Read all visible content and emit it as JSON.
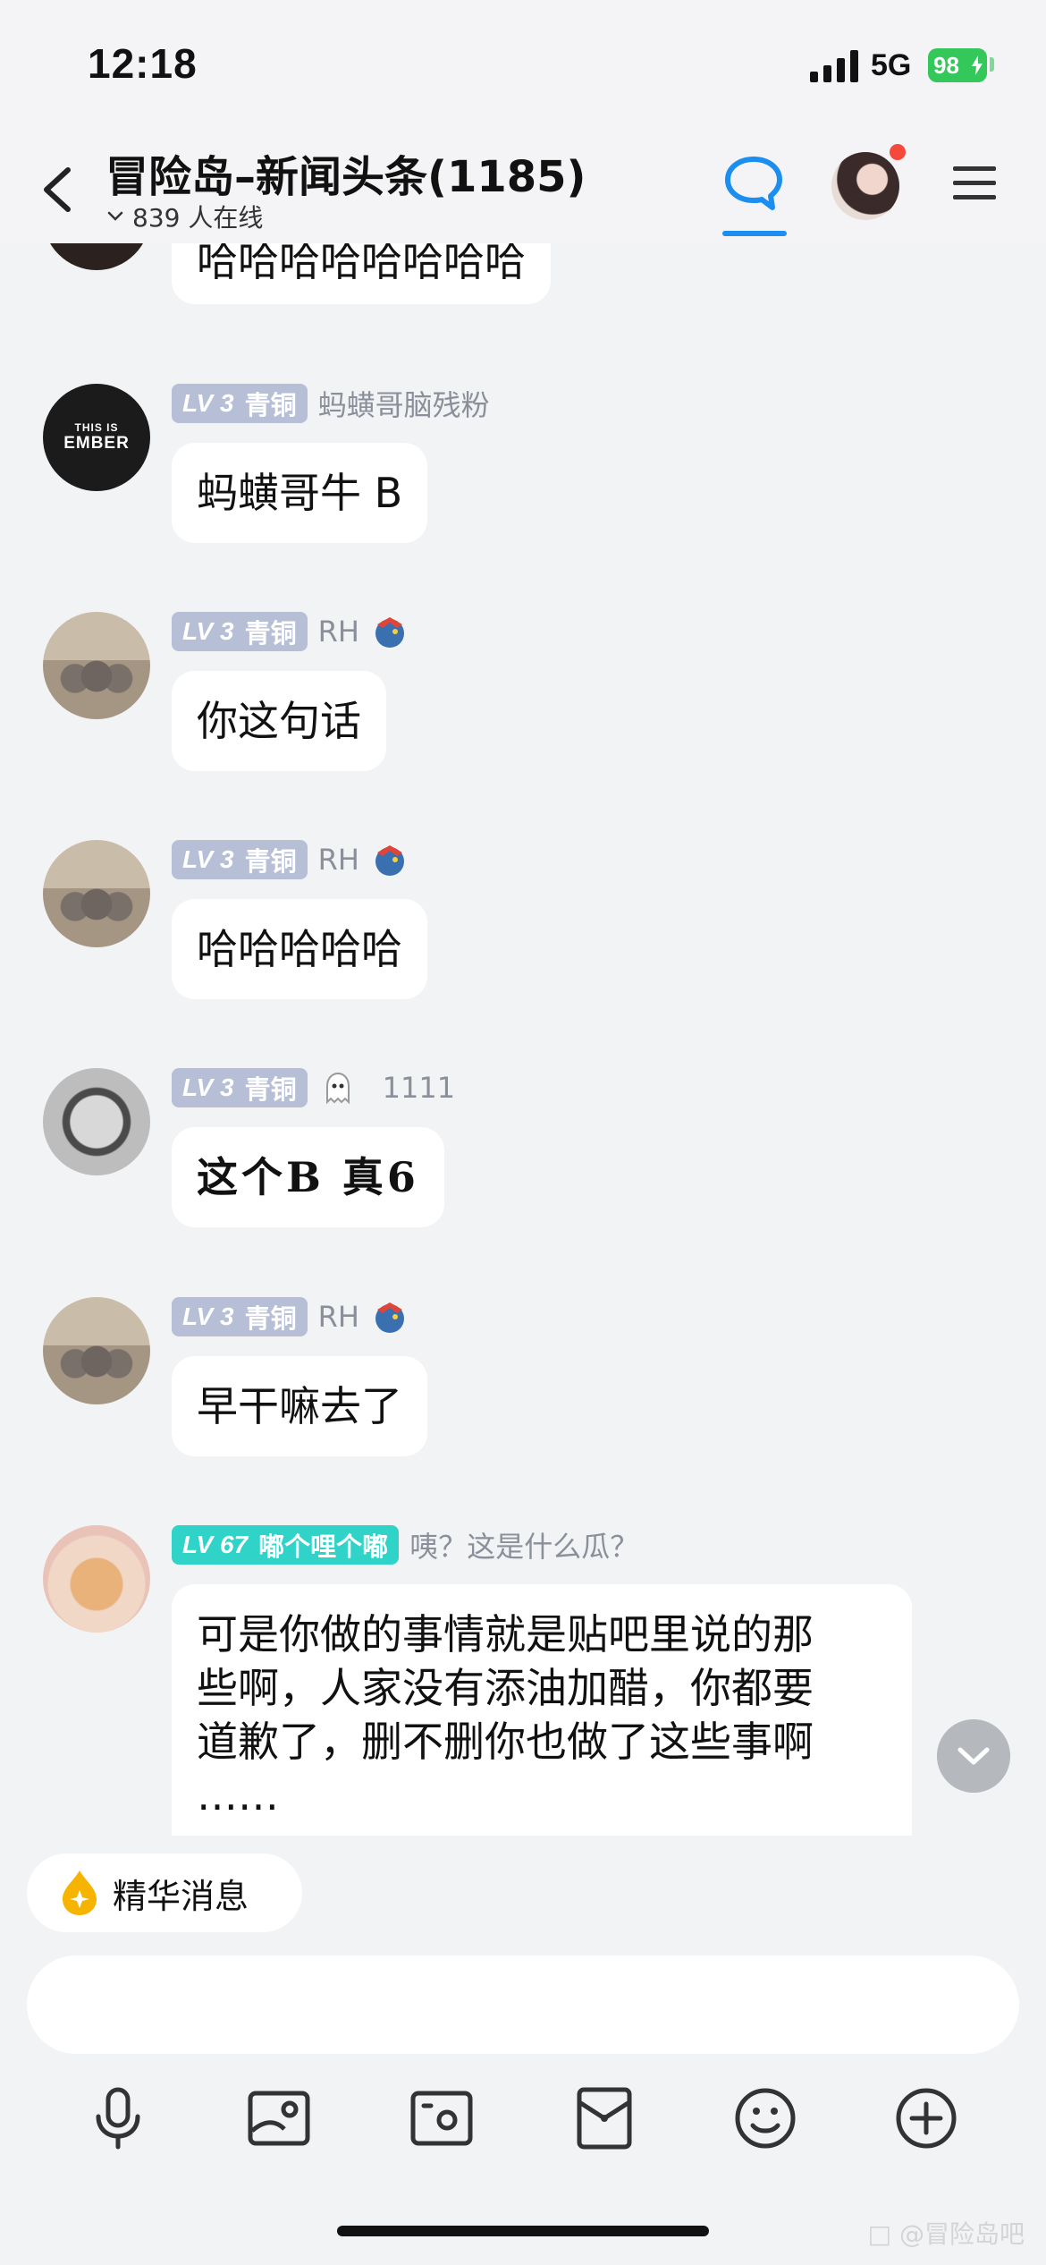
{
  "status_bar": {
    "time": "12:18",
    "network": "5G",
    "battery": "98"
  },
  "header": {
    "title": "冒险岛–新闻头条(1185)",
    "online": "839 人在线"
  },
  "partial_message": {
    "text": "哈哈哈哈哈哈哈哈"
  },
  "messages": [
    {
      "level": "LV 3",
      "rank": "青铜",
      "nickname": "蚂蟥哥脑残粉",
      "text": "蚂蟥哥牛 B",
      "avatar": "ember",
      "avatar_text": [
        "THIS IS",
        "EMBER"
      ]
    },
    {
      "level": "LV 3",
      "rank": "青铜",
      "nickname": "RH",
      "text": "你这句话",
      "avatar": "sand",
      "badge_icon": "dragon-icon"
    },
    {
      "level": "LV 3",
      "rank": "青铜",
      "nickname": "RH",
      "text": "哈哈哈哈哈",
      "avatar": "sand",
      "badge_icon": "dragon-icon"
    },
    {
      "level": "LV 3",
      "rank": "青铜",
      "nickname": "1111",
      "text": "这个B 真6",
      "avatar": "face",
      "badge_icon": "ghost-icon"
    },
    {
      "level": "LV 3",
      "rank": "青铜",
      "nickname": "RH",
      "text": "早干嘛去了",
      "avatar": "sand",
      "badge_icon": "dragon-icon"
    },
    {
      "level": "LV 67",
      "rank": "嘟个哩个嘟",
      "nickname": "咦？这是什么瓜？",
      "avatar": "cat",
      "text_lines": [
        "可是你做的事情就是贴吧里说的那",
        "些啊，人家没有添油加醋，你都要",
        "道歉了，删不删你也做了这些事啊",
        "……"
      ]
    }
  ],
  "bottom": {
    "essence_label": "精华消息",
    "input_value": "",
    "tools": [
      "microphone-icon",
      "image-icon",
      "camera-icon",
      "red-packet-icon",
      "emoji-icon",
      "plus-icon"
    ]
  },
  "watermark": "□ @冒险岛吧"
}
